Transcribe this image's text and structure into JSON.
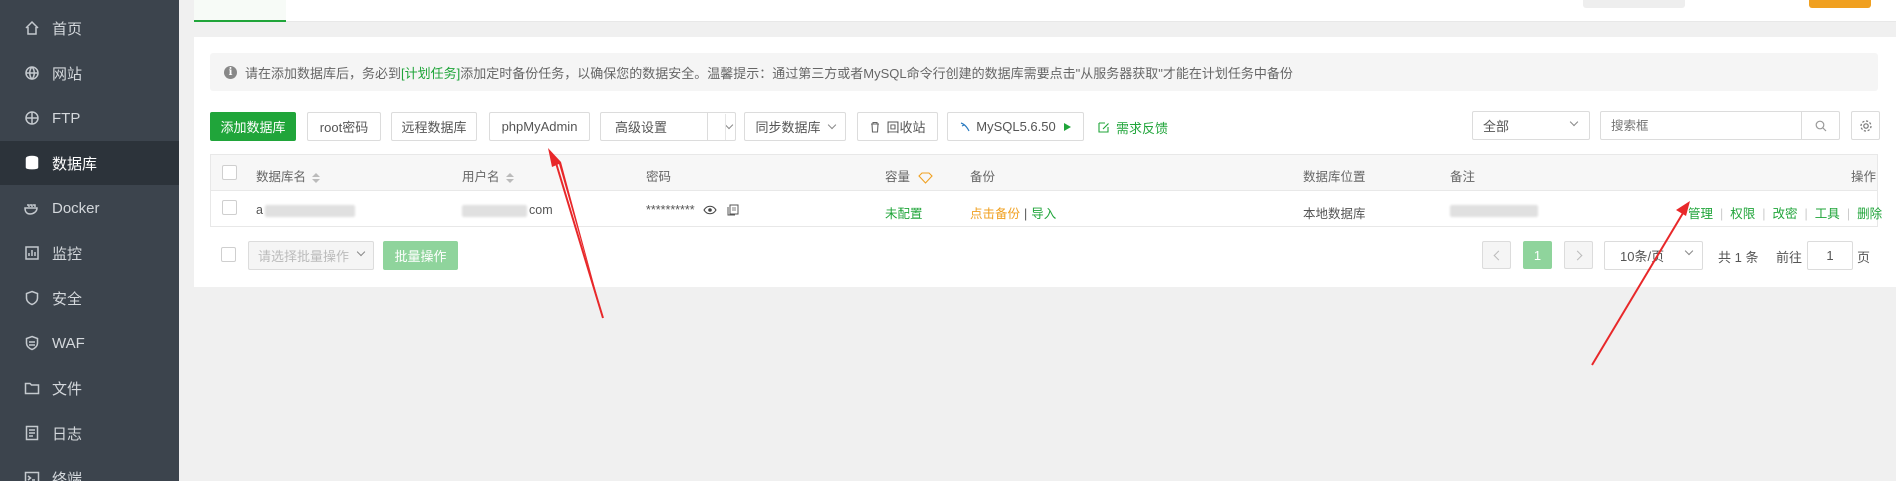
{
  "sidebar": {
    "items": [
      {
        "label": "首页",
        "icon": "home-icon"
      },
      {
        "label": "网站",
        "icon": "globe-icon"
      },
      {
        "label": "FTP",
        "icon": "ftp-icon"
      },
      {
        "label": "数据库",
        "icon": "database-icon",
        "active": true
      },
      {
        "label": "Docker",
        "icon": "docker-icon"
      },
      {
        "label": "监控",
        "icon": "monitor-icon"
      },
      {
        "label": "安全",
        "icon": "shield-icon"
      },
      {
        "label": "WAF",
        "icon": "waf-icon"
      },
      {
        "label": "文件",
        "icon": "folder-icon"
      },
      {
        "label": "日志",
        "icon": "log-icon"
      },
      {
        "label": "终端",
        "icon": "terminal-icon"
      }
    ]
  },
  "notice": {
    "prefix": "请在添加数据库后，务必到",
    "link": "[计划任务]",
    "suffix": "添加定时备份任务，以确保您的数据安全。温馨提示：通过第三方或者MySQL命令行创建的数据库需要点击\"从服务器获取\"才能在计划任务中备份"
  },
  "toolbar": {
    "add_db": "添加数据库",
    "root_pwd": "root密码",
    "remote_db": "远程数据库",
    "phpmyadmin": "phpMyAdmin",
    "advanced": "高级设置",
    "sync_db": "同步数据库",
    "recycle": "回收站",
    "mysql_version": "MySQL5.6.50",
    "feedback": "需求反馈",
    "filter_value": "全部",
    "search_placeholder": "搜索框"
  },
  "table": {
    "headers": {
      "name": "数据库名",
      "user": "用户名",
      "password": "密码",
      "capacity": "容量",
      "backup": "备份",
      "location": "数据库位置",
      "remark": "备注",
      "ops": "操作"
    },
    "rows": [
      {
        "name": "a",
        "user": "com",
        "password": "**********",
        "capacity": "未配置",
        "backup_link": "点击备份",
        "import_link": "导入",
        "location": "本地数据库",
        "ops": [
          "管理",
          "权限",
          "改密",
          "工具",
          "删除"
        ]
      }
    ]
  },
  "batch": {
    "select_placeholder": "请选择批量操作",
    "button": "批量操作"
  },
  "pagination": {
    "current_page": "1",
    "per_page": "10条/页",
    "total": "共 1 条",
    "goto_label": "前往",
    "goto_value": "1",
    "page_suffix": "页"
  },
  "colors": {
    "accent": "#20a53a",
    "sidebar_bg": "#3c444d",
    "warning": "#f0a020",
    "annotation_arrow": "#e8282a"
  }
}
